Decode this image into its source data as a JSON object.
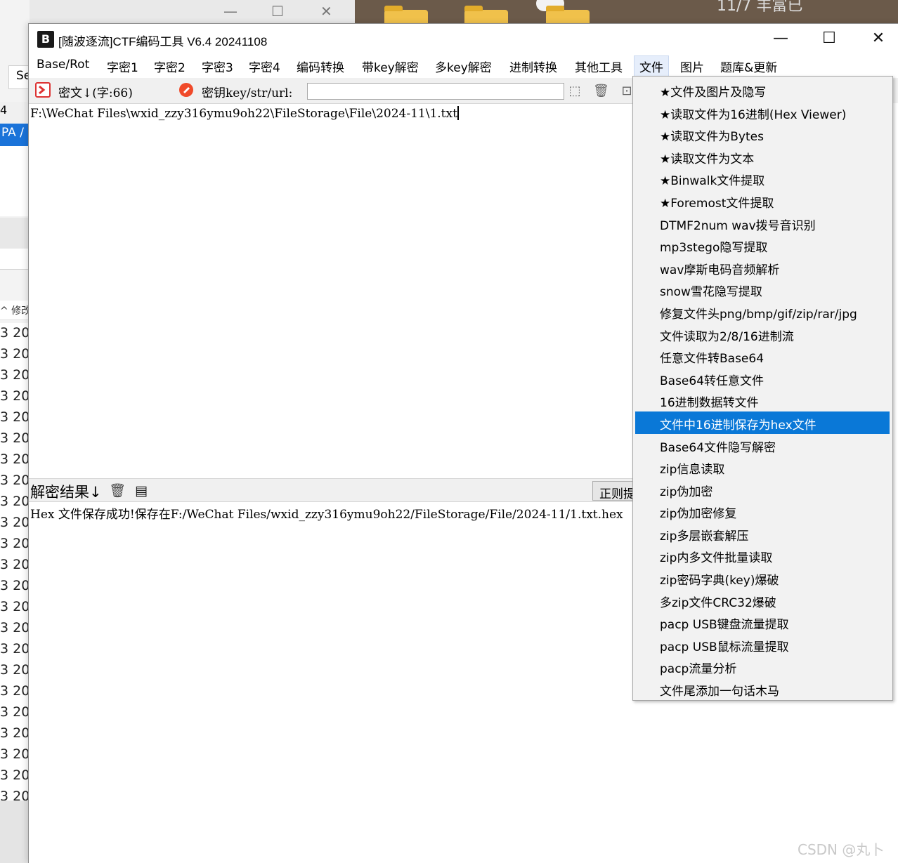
{
  "background": {
    "left_button": "Se",
    "left_selected": "PA /",
    "left_top_label": "4",
    "column_header": "^  修改",
    "row_prefix": "3  20",
    "row_count": 23,
    "desktop_text": "11/7  丰富已"
  },
  "window": {
    "icon": "B",
    "title": "[随波逐流]CTF编码工具 V6.4 20241108",
    "minimize_icon": "minimize-icon",
    "maximize_icon": "maximize-icon",
    "close_icon": "close-icon"
  },
  "menu": {
    "items": [
      "Base/Rot",
      "字密1",
      "字密2",
      "字密3",
      "字密4",
      "编码转换",
      "带key解密",
      "多key解密",
      "进制转换",
      "其他工具",
      "文件",
      "图片",
      "题库&更新"
    ],
    "active_index": 10
  },
  "toolbar": {
    "cipher_label": "密文↓(字:66)",
    "key_label": "密钥key/str/url:",
    "key_value": ""
  },
  "input": {
    "text": "F:\\WeChat Files\\wxid_zzy316ymu9oh22\\FileStorage\\File\\2024-11\\1.txt"
  },
  "result": {
    "label": "解密结果↓",
    "regex_button": "正则提取",
    "text": "Hex 文件保存成功!保存在F:/WeChat Files/wxid_zzy316ymu9oh22/FileStorage/File/2024-11/1.txt.hex"
  },
  "dropdown": {
    "items": [
      "★文件及图片及隐写",
      "★读取文件为16进制(Hex Viewer)",
      "★读取文件为Bytes",
      "★读取文件为文本",
      "★Binwalk文件提取",
      "★Foremost文件提取",
      "DTMF2num  wav拨号音识别",
      "mp3stego隐写提取",
      "wav摩斯电码音频解析",
      "snow雪花隐写提取",
      "修复文件头png/bmp/gif/zip/rar/jpg",
      "文件读取为2/8/16进制流",
      "任意文件转Base64",
      "Base64转任意文件",
      "16进制数据转文件",
      "文件中16进制保存为hex文件",
      "Base64文件隐写解密",
      "zip信息读取",
      "zip伪加密",
      "zip伪加密修复",
      "zip多层嵌套解压",
      "zip内多文件批量读取",
      "zip密码字典(key)爆破",
      "多zip文件CRC32爆破",
      "pacp USB键盘流量提取",
      "pacp USB鼠标流量提取",
      "pacp流量分析",
      "文件尾添加一句话木马"
    ],
    "selected_index": 15
  },
  "watermark": "CSDN @丸卜",
  "colors": {
    "selection": "#0a78d7",
    "toolbar_bg": "#f0f0f0",
    "menu_bg": "#f2f2f2"
  }
}
